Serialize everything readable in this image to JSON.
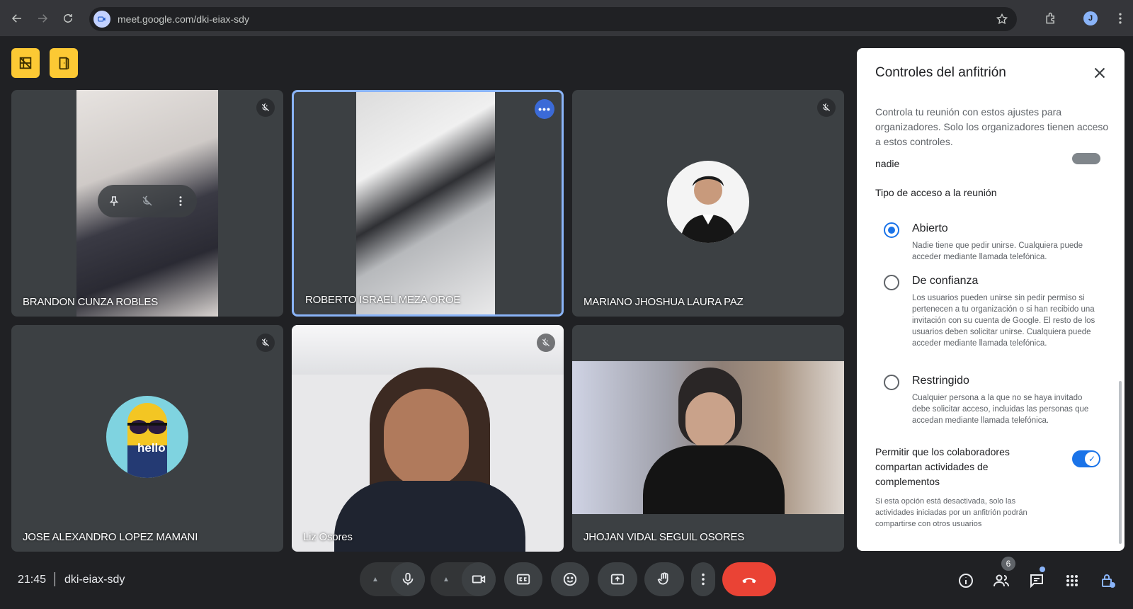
{
  "browser": {
    "url": "meet.google.com/dki-eiax-sdy",
    "profile_initial": "J"
  },
  "tiles": [
    {
      "name": "BRANDON CUNZA ROBLES",
      "muted": true
    },
    {
      "name": "ROBERTO ISRAEL MEZA OROE",
      "muted": false
    },
    {
      "name": "MARIANO JHOSHUA LAURA PAZ",
      "muted": true
    },
    {
      "name": "JOSE ALEXANDRO LOPEZ MAMANI",
      "muted": true,
      "avatar_text": "hello"
    },
    {
      "name": "Liz Osores",
      "muted": true
    },
    {
      "name": "JHOJAN VIDAL SEGUIL OSORES",
      "muted": false
    }
  ],
  "panel": {
    "title": "Controles del anfitrión",
    "description": "Controla tu reunión con estos ajustes para organizadores. Solo los organizadores tienen acceso a estos controles.",
    "partial_label": "nadie",
    "access_heading": "Tipo de acceso a la reunión",
    "options": [
      {
        "label": "Abierto",
        "desc": "Nadie tiene que pedir unirse. Cualquiera puede acceder mediante llamada telefónica.",
        "selected": true
      },
      {
        "label": "De confianza",
        "desc": "Los usuarios pueden unirse sin pedir permiso si pertenecen a tu organización o si han recibido una invitación con su cuenta de Google. El resto de los usuarios deben solicitar unirse. Cualquiera puede acceder mediante llamada telefónica.",
        "selected": false
      },
      {
        "label": "Restringido",
        "desc": "Cualquier persona a la que no se haya invitado debe solicitar acceso, incluidas las personas que accedan mediante llamada telefónica.",
        "selected": false
      }
    ],
    "permission_label": "Permitir que los colaboradores compartan actividades de complementos",
    "permission_enabled": true,
    "permission_note": "Si esta opción está desactivada, solo las actividades iniciadas por un anfitrión podrán compartirse con otros usuarios"
  },
  "bottom": {
    "time": "21:45",
    "meeting_code": "dki-eiax-sdy",
    "participants_count": "6"
  },
  "colors": {
    "hangup": "#ea4335",
    "accent": "#1a73e8",
    "active_border": "#8ab4f8",
    "corner_buttons": "#fcc934"
  }
}
